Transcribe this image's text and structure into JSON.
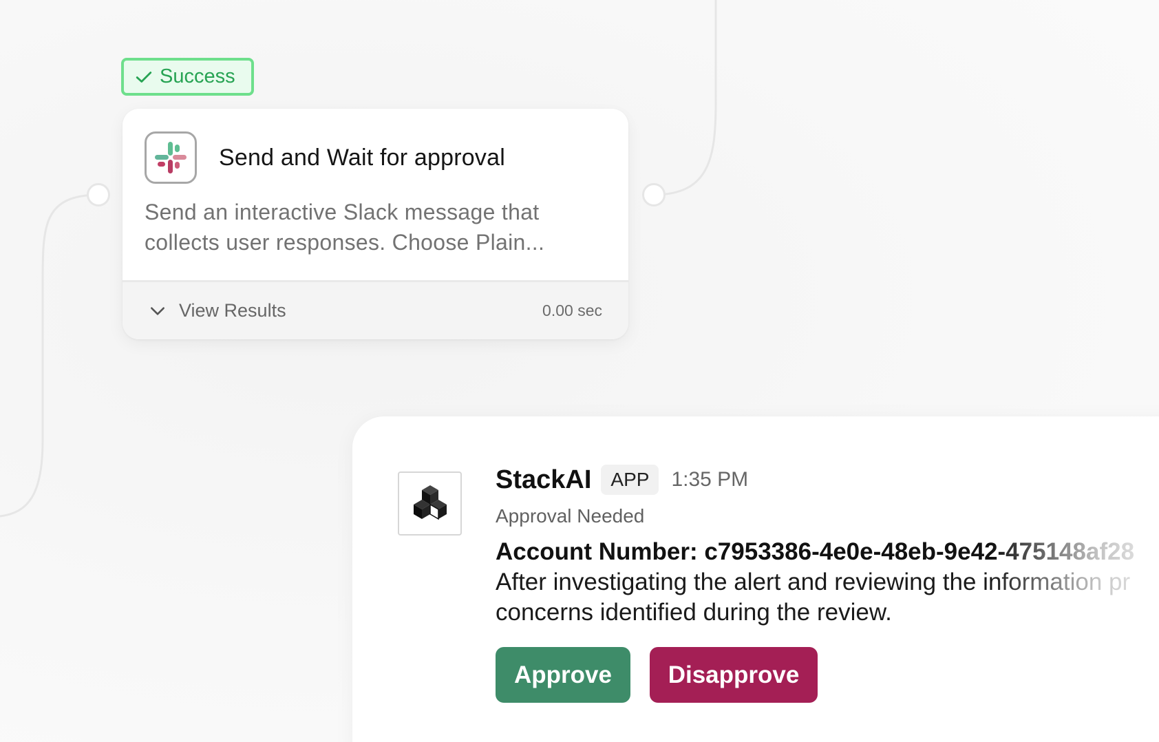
{
  "status_badge": {
    "label": "Success",
    "icon": "check-icon",
    "color": "#27a353"
  },
  "node": {
    "icon": "slack-logo-icon",
    "title": "Send and Wait for approval",
    "description_line1": "Send an interactive Slack message that",
    "description_line2": "collects user responses. Choose Plain...",
    "results_toggle": "View Results",
    "duration": "0.00 sec"
  },
  "message": {
    "app_icon": "stackai-logo-icon",
    "app_name": "StackAI",
    "app_tag": "APP",
    "time": "1:35 PM",
    "subtitle": "Approval Needed",
    "account_line": "Account Number: c7953386-4e0e-48eb-9e42-475148af28",
    "body_line1": "After investigating the alert and reviewing the information pr",
    "body_line2": "concerns identified during the review.",
    "approve_label": "Approve",
    "disapprove_label": "Disapprove"
  },
  "colors": {
    "success_border": "#6edf8c",
    "approve": "#3e8c69",
    "disapprove": "#a41f55"
  }
}
